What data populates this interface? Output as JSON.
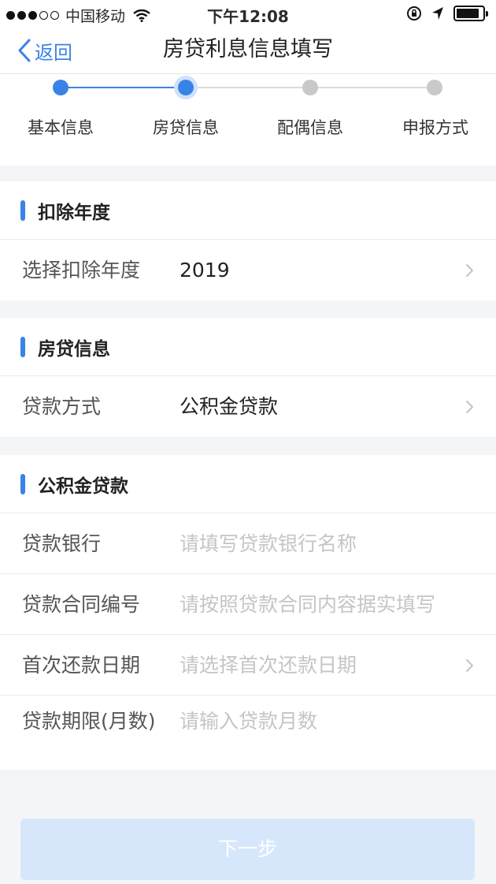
{
  "status_bar": {
    "carrier": "中国移动",
    "time": "下午12:08"
  },
  "nav": {
    "back_label": "返回",
    "title": "房贷利息信息填写"
  },
  "steps": [
    {
      "label": "基本信息",
      "state": "done"
    },
    {
      "label": "房贷信息",
      "state": "current"
    },
    {
      "label": "配偶信息",
      "state": "todo"
    },
    {
      "label": "申报方式",
      "state": "todo"
    }
  ],
  "section_year": {
    "title": "扣除年度",
    "rows": [
      {
        "label": "选择扣除年度",
        "value": "2019"
      }
    ]
  },
  "section_loan": {
    "title": "房贷信息",
    "rows": [
      {
        "label": "贷款方式",
        "value": "公积金贷款"
      }
    ]
  },
  "section_fund": {
    "title": "公积金贷款",
    "rows": [
      {
        "label": "贷款银行",
        "placeholder": "请填写贷款银行名称"
      },
      {
        "label": "贷款合同编号",
        "placeholder": "请按照贷款合同内容据实填写"
      },
      {
        "label": "首次还款日期",
        "placeholder": "请选择首次还款日期"
      },
      {
        "label": "贷款期限(月数)",
        "placeholder": "请输入贷款月数"
      }
    ]
  },
  "next_button": "下一步",
  "colors": {
    "accent": "#3a83e6",
    "disabled_button": "#d7e7fb",
    "placeholder": "#c5c5c5"
  }
}
